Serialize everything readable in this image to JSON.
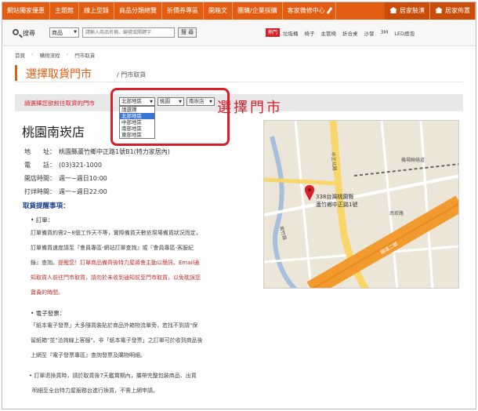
{
  "topnav": {
    "items": [
      "網站獨家優惠",
      "主題館",
      "線上型錄",
      "商品分類總覽",
      "折價券專區",
      "開箱文",
      "團購/企業採購",
      "客家微修中心"
    ],
    "right": [
      "居家裝潢",
      "居家佈置"
    ]
  },
  "search": {
    "label": "搜尋",
    "category": "商品",
    "placeholder": "請輸入商品名稱、編號或關鍵字",
    "button": "搜 尋",
    "hot_label": "熱門",
    "hot_links": [
      "垃圾桶",
      "椅子",
      "主管椅",
      "折合桌",
      "沙發",
      "3M",
      "LED燈泡"
    ]
  },
  "breadcrumb": [
    "首頁",
    "購物流程",
    "門市取貨"
  ],
  "page": {
    "title": "選擇取貨門市",
    "subtitle": "/ 門市取貨"
  },
  "store_select": {
    "label": "請選擇您欲前往取貨的門市",
    "region": "北部地區",
    "city": "桃園",
    "store": "南崁店",
    "region_options": [
      "請選擇",
      "北部地區",
      "中部地區",
      "南部地區",
      "東部地區"
    ],
    "selected_index": 1,
    "annotation": "選擇門市"
  },
  "store": {
    "name": "桃園南崁店",
    "address_label": "地　　址：",
    "address": "桃園縣蘆竹鄉中正路1號B1(特力家居內)",
    "phone_label": "電　　話：",
    "phone": "(03)321-1000",
    "open_label": "開店時間：",
    "open": "週一~週日10:00",
    "close_label": "打烊時間：",
    "close": "週一~週日22:00"
  },
  "notice": {
    "title": "取貨提醒事項：",
    "order_label": "• 訂單：",
    "order_lines": [
      "訂單備貨約需2~8個工作天不等，實際備貨天數依現場備貨狀況而定，",
      "訂單備貨速度請至『會員專區-網站訂單查詢』或『會員專區-客服紀"
    ],
    "order_line3_a": "錄』查詢。",
    "order_line3_b": "提醒您！訂單商品備齊後特力屋將會主動以簡訊、Email通",
    "order_red_lines": [
      "知取貨人前往門市取貨，請勿於未收到通知前至門市取貨，以免耽誤您",
      "寶貴的時間。"
    ],
    "invoice_label": "• 電子發票：",
    "invoice_lines": [
      "「紙本電子發票」大多隨貨裝貼於商品外箱物流單旁，若找不到請\"保",
      "留紙箱\"並\"洽詢線上客服\"。非「紙本電子發票」之訂單可於收到商品後",
      "上網至『電子發票專區』查詢發票及購物明細。"
    ],
    "exchange_lines": [
      "• 訂單退換貨時，請於取貨後7天鑑賞期內，攜帶完整包裝商品、出貨",
      "明細至全台特力屋服務台進行換貨，不需上網申請。"
    ]
  },
  "map": {
    "marker_text_1": "338台灣桃園縣",
    "marker_text_2": "蘆竹鄉中正路1號",
    "road_labels": [
      "中正北路",
      "南崁路",
      "國道二號",
      "機場聯絡道",
      "南竹路"
    ]
  },
  "colors": {
    "brand": "#e25d12",
    "accent_red": "#d8202a",
    "link_blue": "#1a3e8f"
  }
}
